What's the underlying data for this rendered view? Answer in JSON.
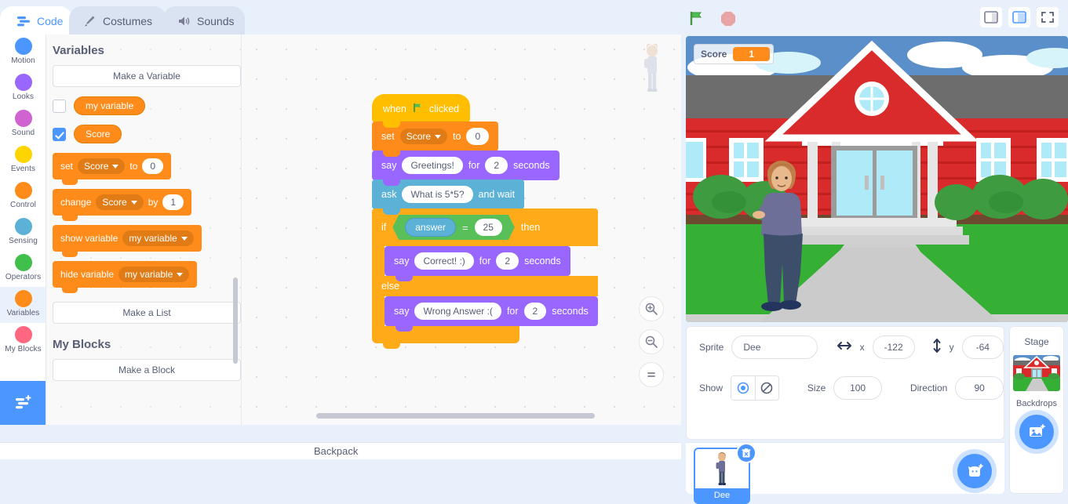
{
  "tabs": [
    {
      "label": "Code",
      "icon": "code-icon",
      "active": true
    },
    {
      "label": "Costumes",
      "icon": "paintbrush-icon",
      "active": false
    },
    {
      "label": "Sounds",
      "icon": "speaker-icon",
      "active": false
    }
  ],
  "controls": {
    "green_flag": "green-flag-icon",
    "stop": "stop-icon"
  },
  "layout_buttons": [
    "small-stage-icon",
    "large-stage-icon",
    "fullscreen-icon"
  ],
  "categories": [
    {
      "label": "Motion",
      "color": "#4c97ff",
      "selected": false
    },
    {
      "label": "Looks",
      "color": "#9966ff",
      "selected": false
    },
    {
      "label": "Sound",
      "color": "#cf63cf",
      "selected": false
    },
    {
      "label": "Events",
      "color": "#ffd500",
      "selected": false
    },
    {
      "label": "Control",
      "color": "#ff8c1a",
      "selected": false
    },
    {
      "label": "Sensing",
      "color": "#5cb1d6",
      "selected": false
    },
    {
      "label": "Operators",
      "color": "#40bf4a",
      "selected": false
    },
    {
      "label": "Variables",
      "color": "#ff8c1a",
      "selected": true
    },
    {
      "label": "My Blocks",
      "color": "#ff6680",
      "selected": false
    }
  ],
  "palette": {
    "heading": "Variables",
    "make_variable": "Make a Variable",
    "variables": [
      {
        "name": "my variable",
        "checked": false
      },
      {
        "name": "Score",
        "checked": true
      }
    ],
    "blocks": {
      "set_label": "set",
      "set_var": "Score",
      "set_to": "to",
      "set_value": "0",
      "change_label": "change",
      "change_var": "Score",
      "change_by": "by",
      "change_value": "1",
      "show_variable": "show variable",
      "show_var": "my variable",
      "hide_variable": "hide variable",
      "hide_var": "my variable"
    },
    "make_list": "Make a List",
    "myblocks_heading": "My Blocks",
    "make_block": "Make a Block"
  },
  "script": {
    "hat": {
      "when": "when",
      "flag": "green-flag-icon",
      "clicked": "clicked"
    },
    "set": {
      "label": "set",
      "variable": "Score",
      "to": "to",
      "value": "0"
    },
    "say1": {
      "label": "say",
      "message": "Greetings!",
      "for": "for",
      "seconds_value": "2",
      "seconds": "seconds"
    },
    "ask": {
      "label": "ask",
      "question": "What is 5*5?",
      "and_wait": "and wait"
    },
    "if": {
      "label": "if",
      "then": "then",
      "else": "else"
    },
    "condition": {
      "left": "answer",
      "operator": "=",
      "right": "25"
    },
    "say2": {
      "label": "say",
      "message": "Correct! :)",
      "for": "for",
      "seconds_value": "2",
      "seconds": "seconds"
    },
    "say3": {
      "label": "say",
      "message": "Wrong Answer :(",
      "for": "for",
      "seconds_value": "2",
      "seconds": "seconds"
    }
  },
  "workspace": {
    "zoom_in": "zoom-in-icon",
    "zoom_out": "zoom-out-icon",
    "zoom_reset": "zoom-reset-icon"
  },
  "stage": {
    "monitor": {
      "name": "Score",
      "value": "1"
    }
  },
  "sprite_info": {
    "sprite_label": "Sprite",
    "sprite_name": "Dee",
    "x_label": "x",
    "x_value": "-122",
    "y_label": "y",
    "y_value": "-64",
    "show_label": "Show",
    "size_label": "Size",
    "size_value": "100",
    "direction_label": "Direction",
    "direction_value": "90"
  },
  "sprite_list": {
    "items": [
      {
        "name": "Dee",
        "selected": true
      }
    ],
    "add_sprite": "add-sprite-icon",
    "delete": "delete-icon"
  },
  "stage_selector": {
    "title": "Stage",
    "subtitle": "Backdrops",
    "add_backdrop": "add-backdrop-icon"
  },
  "backpack": {
    "label": "Backpack"
  },
  "colors": {
    "accent": "#4c97ff",
    "variables": "#ff8c1a",
    "looks": "#9966ff",
    "sensing": "#5cb1d6",
    "control": "#ffab19",
    "events": "#ffbf00",
    "operators": "#59c059"
  }
}
